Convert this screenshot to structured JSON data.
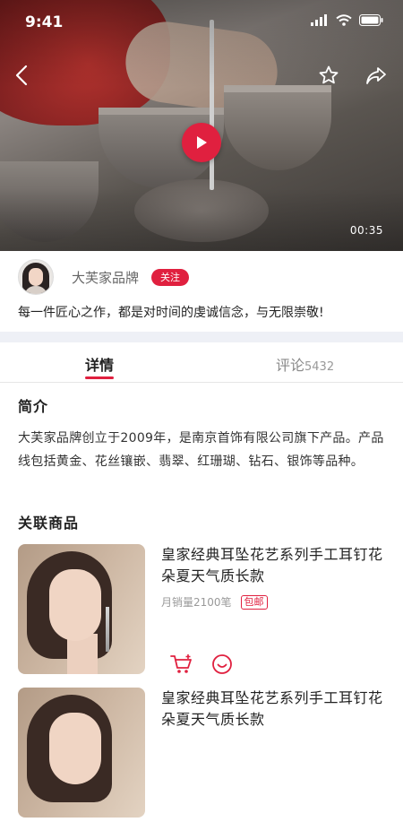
{
  "status_bar": {
    "time": "9:41"
  },
  "video": {
    "duration": "00:35"
  },
  "author": {
    "name": "大芙家品牌",
    "follow_label": "关注"
  },
  "slogan": "每一件匠心之作，都是对时间的虔诚信念，与无限崇敬!",
  "tabs": {
    "details_label": "详情",
    "reviews_label": "评论",
    "reviews_count": "5432"
  },
  "intro": {
    "title": "简介",
    "text": "大芙家品牌创立于2009年，是南京首饰有限公司旗下产品。产品线包括黄金、花丝镶嵌、翡翠、红珊瑚、钻石、银饰等品种。"
  },
  "related": {
    "title": "关联商品",
    "items": [
      {
        "title": "皇家经典耳坠花艺系列手工耳钉花朵夏天气质长款",
        "sales": "月销量2100笔",
        "badge": "包邮"
      },
      {
        "title": "皇家经典耳坠花艺系列手工耳钉花朵夏天气质长款"
      }
    ]
  },
  "colors": {
    "accent": "#e0203f"
  },
  "icons": [
    "back-icon",
    "star-icon",
    "share-icon",
    "play-icon",
    "cart-add-icon",
    "service-icon",
    "signal-icon",
    "wifi-icon",
    "battery-icon"
  ]
}
